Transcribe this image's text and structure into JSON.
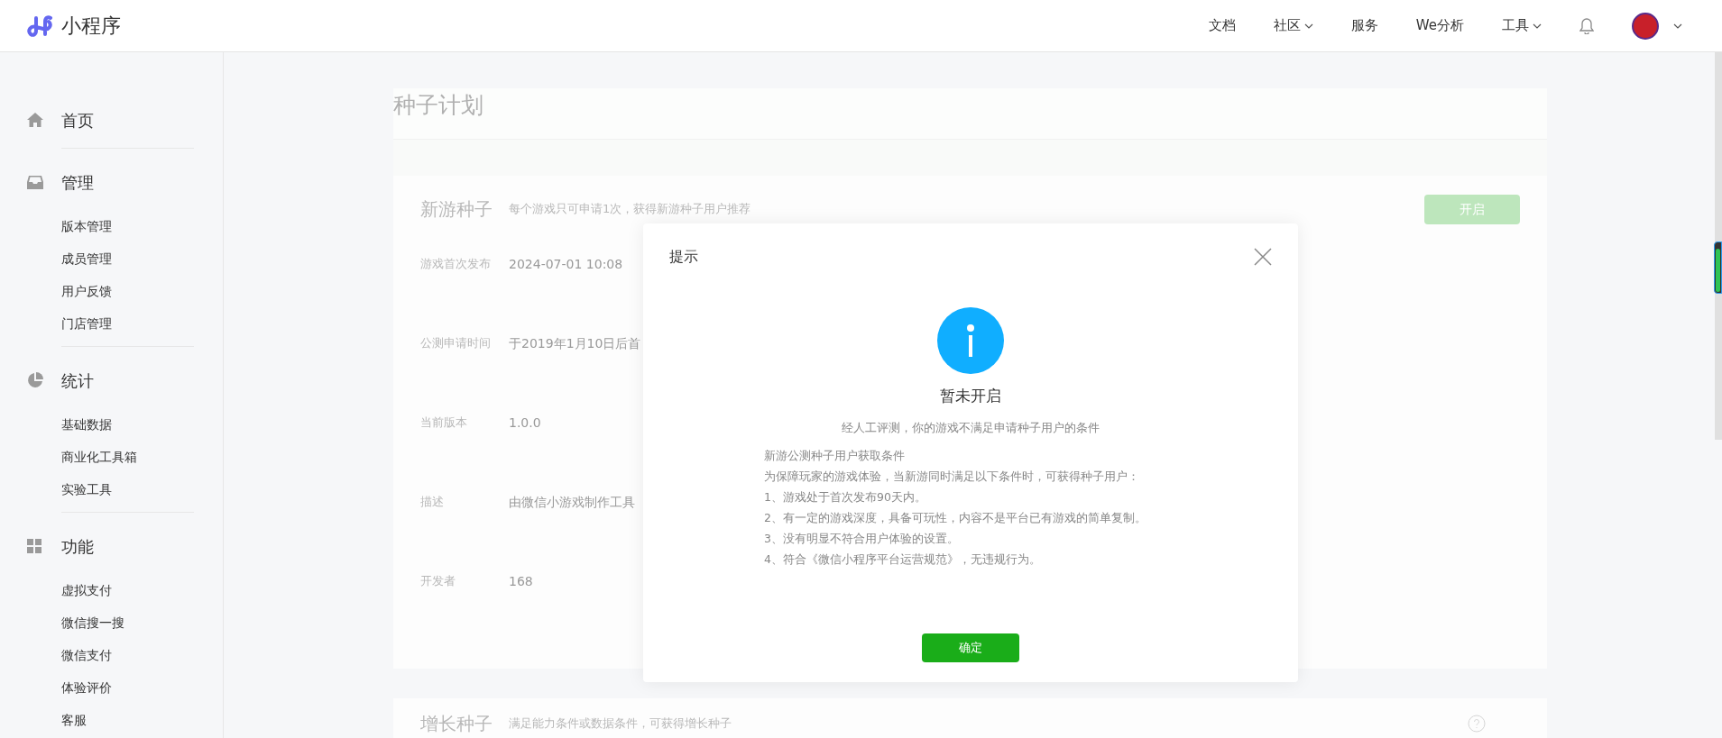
{
  "header": {
    "logo_text": "小程序",
    "nav": [
      {
        "label": "文档",
        "dropdown": false
      },
      {
        "label": "社区",
        "dropdown": true
      },
      {
        "label": "服务",
        "dropdown": false
      },
      {
        "label": "We分析",
        "dropdown": false
      },
      {
        "label": "工具",
        "dropdown": true
      }
    ]
  },
  "sidebar": [
    {
      "kind": "home",
      "title": "首页"
    },
    {
      "kind": "manage",
      "title": "管理",
      "items": [
        "版本管理",
        "成员管理",
        "用户反馈",
        "门店管理"
      ]
    },
    {
      "kind": "stats",
      "title": "统计",
      "items": [
        "基础数据",
        "商业化工具箱",
        "实验工具"
      ]
    },
    {
      "kind": "features",
      "title": "功能",
      "items": [
        "虚拟支付",
        "微信搜一搜",
        "微信支付",
        "体验评价",
        "客服"
      ]
    }
  ],
  "main": {
    "title": "种子计划",
    "cards": [
      {
        "title": "新游种子",
        "subtitle": "每个游戏只可申请1次，获得新游种子用户推荐",
        "button": "开启",
        "fields": [
          {
            "label": "游戏首次发布",
            "value": "2024-07-01 10:08"
          },
          {
            "label": "公测申请时间",
            "value": "于2019年1月10日后首"
          },
          {
            "label": "当前版本",
            "value": "1.0.0"
          },
          {
            "label": "描述",
            "value": "由微信小游戏制作工具"
          },
          {
            "label": "开发者",
            "value": "168"
          }
        ]
      },
      {
        "title": "增长种子",
        "subtitle": "满足能力条件或数据条件，可获得增长种子",
        "help": true
      }
    ]
  },
  "dialog": {
    "title": "提示",
    "status": "暂未开启",
    "message": "经人工评测，你的游戏不满足申请种子用户的条件",
    "lines": [
      "新游公测种子用户获取条件",
      "为保障玩家的游戏体验，当新游同时满足以下条件时，可获得种子用户：",
      "1、游戏处于首次发布90天内。",
      "2、有一定的游戏深度，具备可玩性，内容不是平台已有游戏的简单复制。",
      "3、没有明显不符合用户体验的设置。",
      "4、符合《微信小程序平台运营规范》，无违规行为。"
    ],
    "confirm": "确定"
  }
}
